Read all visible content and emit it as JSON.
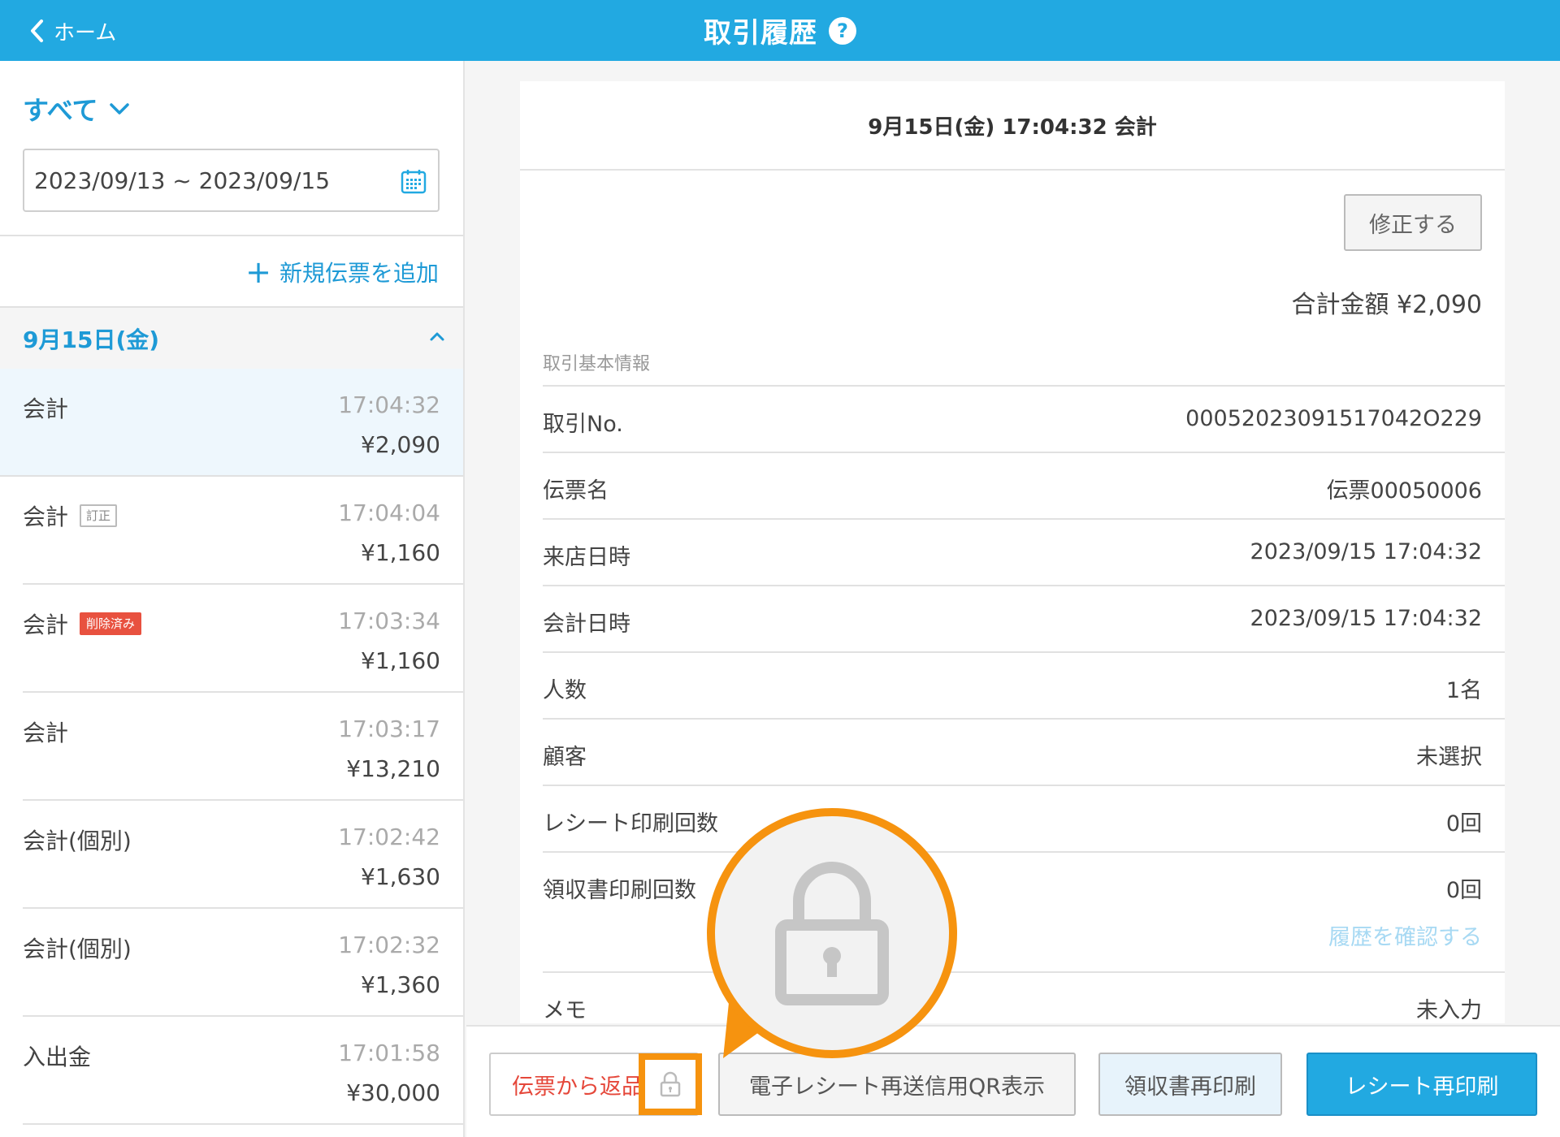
{
  "header": {
    "back_label": "ホーム",
    "title": "取引履歴",
    "help_label": "?"
  },
  "sidebar": {
    "filter_label": "すべて",
    "date_range": "2023/09/13 ~ 2023/09/15",
    "add_slip_label": "新規伝票を追加",
    "add_slip_plus": "+",
    "date_header": "9月15日(金)",
    "transactions": [
      {
        "name": "会計",
        "badge": "",
        "time": "17:04:32",
        "amount": "¥2,090"
      },
      {
        "name": "会計",
        "badge": "訂正",
        "time": "17:04:04",
        "amount": "¥1,160"
      },
      {
        "name": "会計",
        "badge": "削除済み",
        "time": "17:03:34",
        "amount": "¥1,160"
      },
      {
        "name": "会計",
        "badge": "",
        "time": "17:03:17",
        "amount": "¥13,210"
      },
      {
        "name": "会計(個別)",
        "badge": "",
        "time": "17:02:42",
        "amount": "¥1,630"
      },
      {
        "name": "会計(個別)",
        "badge": "",
        "time": "17:02:32",
        "amount": "¥1,360"
      },
      {
        "name": "入出金",
        "badge": "",
        "time": "17:01:58",
        "amount": "¥30,000"
      }
    ]
  },
  "detail": {
    "title": "9月15日(金) 17:04:32 会計",
    "edit_label": "修正する",
    "total": "合計金額 ¥2,090",
    "section_label": "取引基本情報",
    "rows": [
      {
        "label": "取引No.",
        "value": "00052023091517042O229"
      },
      {
        "label": "伝票名",
        "value": "伝票00050006"
      },
      {
        "label": "来店日時",
        "value": "2023/09/15 17:04:32"
      },
      {
        "label": "会計日時",
        "value": "2023/09/15 17:04:32"
      },
      {
        "label": "人数",
        "value": "1名"
      },
      {
        "label": "顧客",
        "value": "未選択"
      },
      {
        "label": "レシート印刷回数",
        "value": "0回"
      },
      {
        "label": "領収書印刷回数",
        "value": "0回",
        "link": "履歴を確認する"
      },
      {
        "label": "メモ",
        "value": "未入力"
      }
    ]
  },
  "toolbar": {
    "return_label": "伝票から返品",
    "qr_label": "電子レシート再送信用QR表示",
    "receipt_label": "領収書再印刷",
    "reprint_label": "レシート再印刷"
  },
  "colors": {
    "header_bg": "#22a9e1",
    "accent": "#1e9ad6",
    "highlight": "#f6930f",
    "danger": "#e8513f"
  }
}
